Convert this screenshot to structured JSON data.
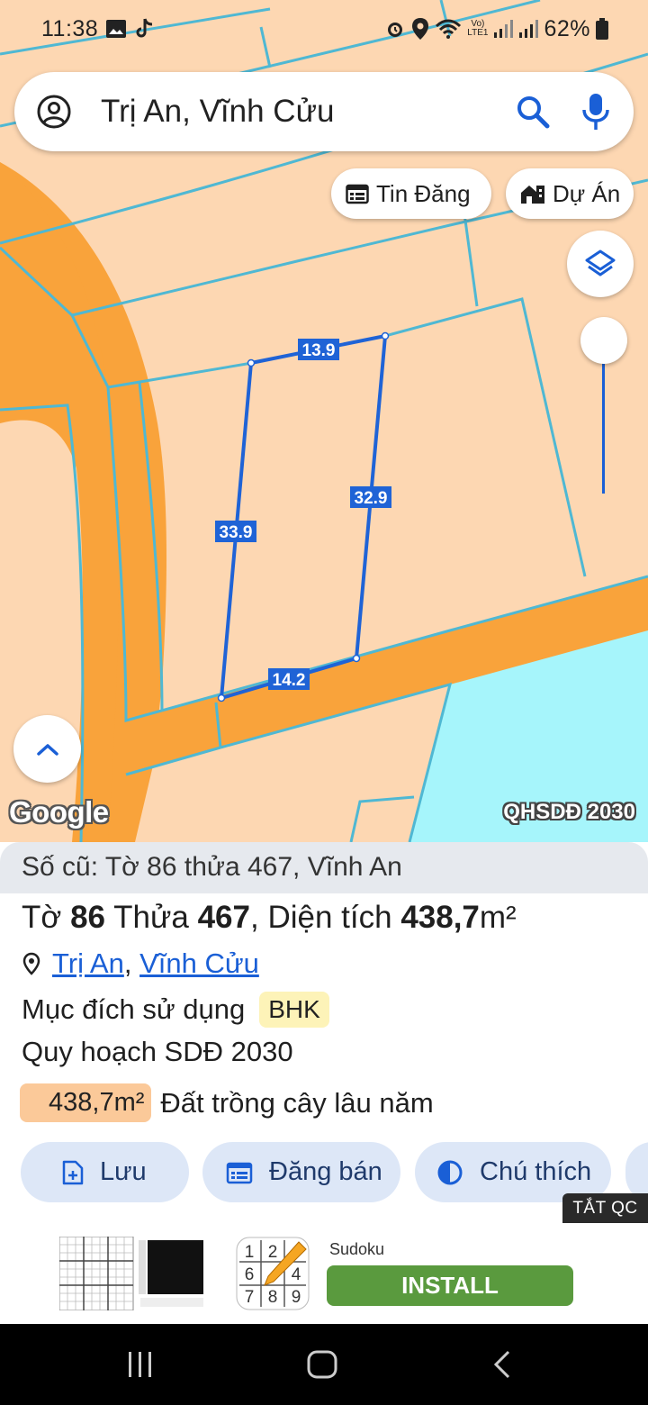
{
  "status_bar": {
    "time": "11:38",
    "battery": "62%",
    "network": "LTE1"
  },
  "search": {
    "query": "Trị An, Vĩnh Cửu"
  },
  "chips": {
    "listings": "Tin Đăng",
    "projects": "Dự Án"
  },
  "map": {
    "edge_labels": [
      "13.9",
      "32.9",
      "33.9",
      "14.2"
    ],
    "attribution": "Google",
    "layer_label": "QHSDĐ 2030",
    "colors": {
      "land": "#fdd7b2",
      "road": "#f9a33b",
      "water": "#a6f5fb",
      "lot_line": "#4fb8d3",
      "parcel": "#1f63d6"
    }
  },
  "sheet": {
    "old_id": "Số cũ: Tờ 86 thửa 467, Vĩnh An",
    "sheet_word": "Tờ",
    "sheet_no": "86",
    "parcel_word": "Thửa",
    "parcel_no": "467",
    "area_word": "Diện tích",
    "area_value": "438,7",
    "area_unit": "m²",
    "location": {
      "ward": "Trị An",
      "district": "Vĩnh Cửu"
    },
    "purpose_label": "Mục đích sử dụng",
    "purpose_code": "BHK",
    "plan_label": "Quy hoạch SDĐ 2030",
    "plan_area": "438,7m²",
    "plan_type": "Đất trồng cây lâu năm"
  },
  "actions": {
    "save": "Lưu",
    "post": "Đăng bán",
    "legend": "Chú thích"
  },
  "ads": {
    "close_label": "TẮT QC",
    "app_name": "Sudoku",
    "install_label": "INSTALL",
    "icon_digits": [
      "1",
      "2",
      "6",
      "4",
      "7",
      "8",
      "9"
    ]
  }
}
